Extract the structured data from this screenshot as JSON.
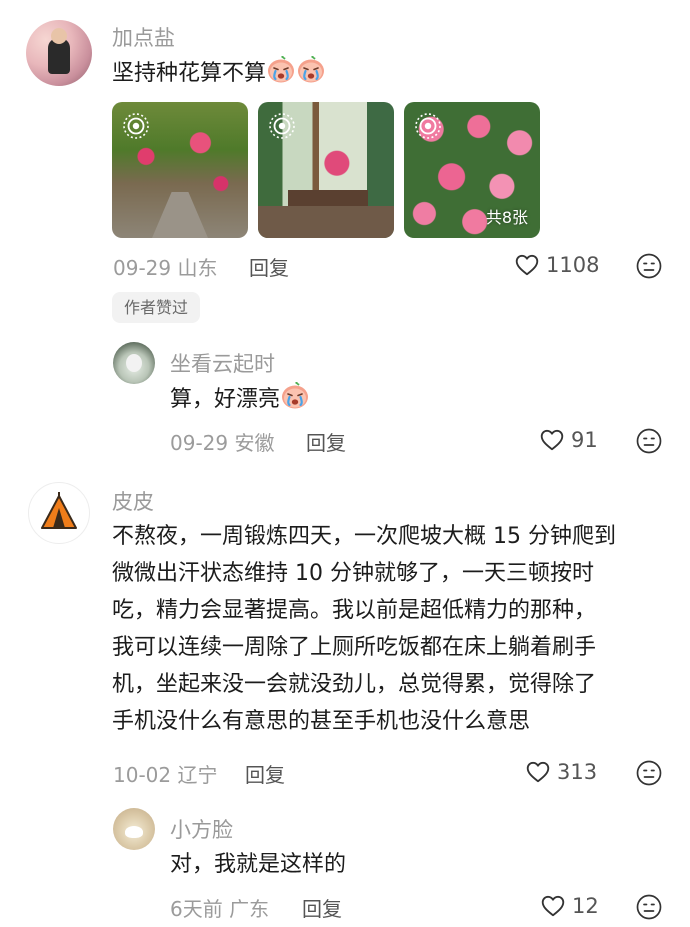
{
  "comments": [
    {
      "name": "加点盐",
      "text": "坚持种花算不算",
      "images": {
        "count_label": "共8张"
      },
      "date": "09-29",
      "location": "山东",
      "reply_label": "回复",
      "likes": "1108",
      "badge": "作者赞过"
    },
    {
      "name": "坐看云起时",
      "text": "算，好漂亮",
      "date": "09-29",
      "location": "安徽",
      "reply_label": "回复",
      "likes": "91"
    },
    {
      "name": "皮皮",
      "lines": [
        "不熬夜，一周锻炼四天，一次爬坡大概 15 分钟爬到",
        "微微出汗状态维持 10 分钟就够了，一天三顿按时",
        "吃，精力会显著提高。我以前是超低精力的那种，",
        "我可以连续一周除了上厕所吃饭都在床上躺着刷手",
        "机，坐起来没一会就没劲儿，总觉得累，觉得除了",
        "手机没什么有意思的甚至手机也没什么意思"
      ],
      "date": "10-02",
      "location": "辽宁",
      "reply_label": "回复",
      "likes": "313"
    },
    {
      "name": "小方脸",
      "text": "对，我就是这样的",
      "date": "6天前",
      "location": "广东",
      "reply_label": "回复",
      "likes": "12"
    }
  ],
  "icons": {
    "like": "heart-outline-icon",
    "dislike": "dislike-face-icon",
    "live": "live-photo-icon",
    "emoji": "crying-face-emoji"
  },
  "colors": {
    "text": "#1c1c1c",
    "meta": "#9b9b9b",
    "reply": "#555555",
    "badge_bg": "#f2f2f2"
  }
}
